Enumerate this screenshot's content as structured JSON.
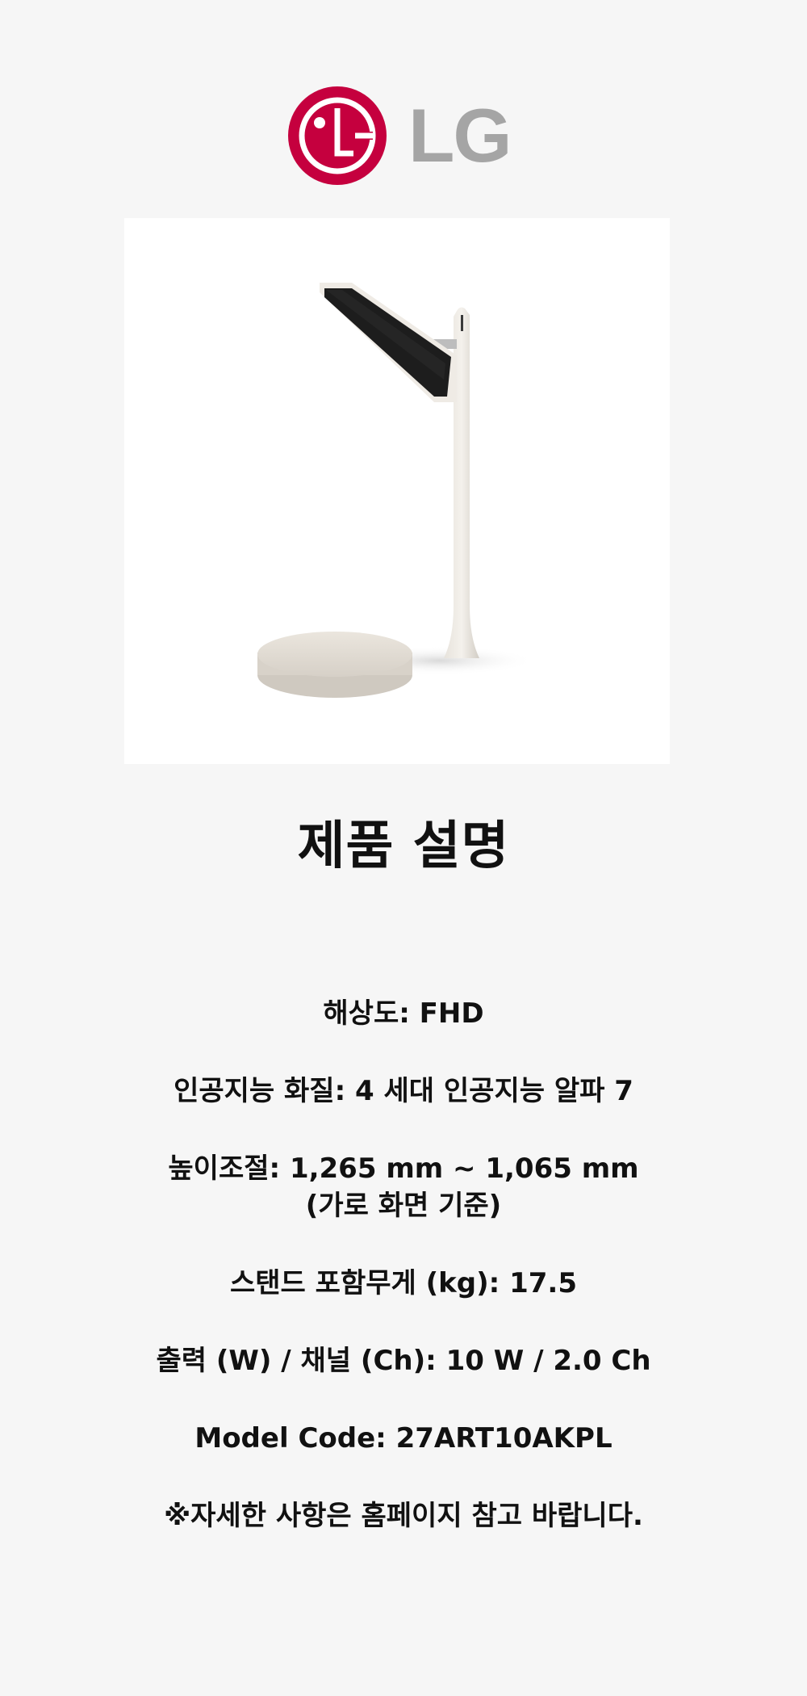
{
  "brand": {
    "name": "LG",
    "logo_red": "#c5003e",
    "wordmark_gray": "#a5a5a5"
  },
  "product_image": {
    "alt": "LG StanbyME Go product image"
  },
  "section_title": "제품 설명",
  "specs": [
    {
      "line1": "해상도: FHD"
    },
    {
      "line1": "인공지능 화질: 4 세대 인공지능 알파 7"
    },
    {
      "line1": "높이조절: 1,265 mm ~ 1,065 mm",
      "line2": "(가로 화면 기준)"
    },
    {
      "line1": "스탠드 포함무게 (kg): 17.5"
    },
    {
      "line1": "출력 (W) / 채널 (Ch): 10 W / 2.0 Ch"
    },
    {
      "line1": "Model Code: 27ART10AKPL"
    },
    {
      "line1": "※자세한 사항은 홈페이지 참고 바랍니다."
    }
  ]
}
